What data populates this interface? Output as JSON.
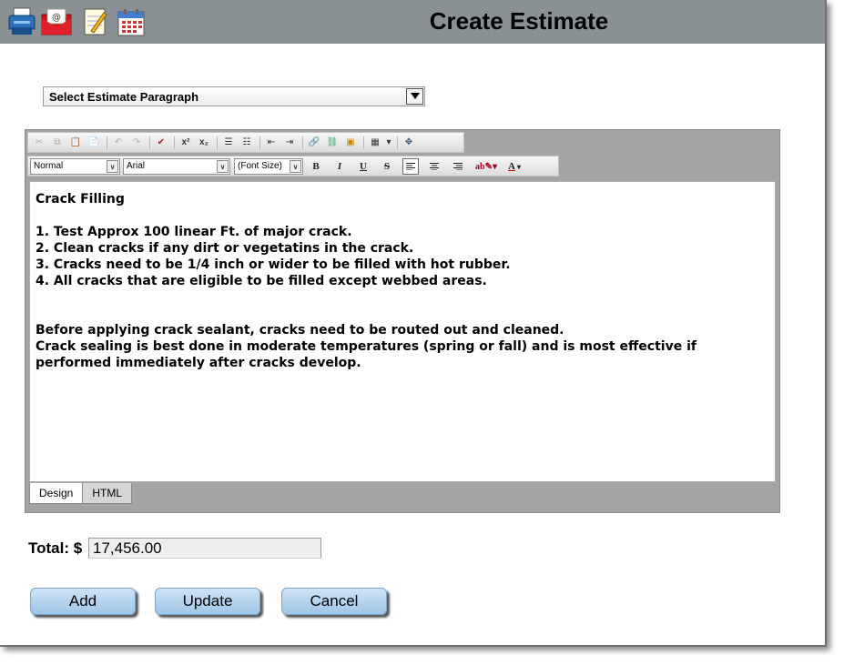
{
  "titlebar": {
    "title": "Create Estimate",
    "icons": [
      "printer-icon",
      "email-icon",
      "notepad-icon",
      "calendar-icon"
    ],
    "background": "#8a9195"
  },
  "paragraph_select": {
    "selected": "Select Estimate Paragraph"
  },
  "toolbar": {
    "style_combo": "Normal",
    "font_combo": "Arial",
    "size_combo": "(Font Size)",
    "bold": "B",
    "italic": "I",
    "underline": "U",
    "strike": "S",
    "font_color": "A"
  },
  "editor": {
    "heading": "Crack Filling",
    "items": [
      "1. Test Approx 100 linear Ft. of major crack.",
      "2. Clean cracks if any dirt or vegetatins in the crack.",
      "3. Cracks need to be 1/4 inch or wider to be filled with hot rubber.",
      "4. All cracks that are eligible to be filled except webbed areas."
    ],
    "paragraph1": "Before applying crack sealant, cracks need to be routed out and cleaned.",
    "paragraph2": "Crack sealing is best done in moderate temperatures (spring or fall) and is most effective if performed immediately after cracks develop.",
    "tabs": [
      "Design",
      "HTML"
    ]
  },
  "total": {
    "label": "Total: $",
    "value": "17,456.00"
  },
  "buttons": {
    "add": "Add",
    "update": "Update",
    "cancel": "Cancel"
  },
  "colors": {
    "button_top": "#cfe3f5",
    "button_bottom": "#9ec5e8"
  }
}
